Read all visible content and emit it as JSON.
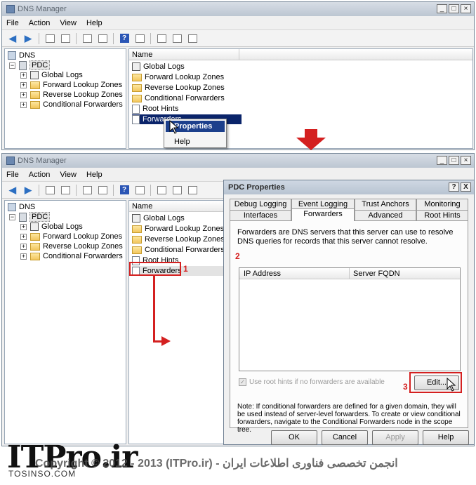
{
  "top_window": {
    "title": "DNS Manager",
    "menu": [
      "File",
      "Action",
      "View",
      "Help"
    ],
    "tree": {
      "root": "DNS",
      "server": "PDC",
      "children": [
        "Global Logs",
        "Forward Lookup Zones",
        "Reverse Lookup Zones",
        "Conditional Forwarders"
      ]
    },
    "list_header": "Name",
    "list_items": [
      "Global Logs",
      "Forward Lookup Zones",
      "Reverse Lookup Zones",
      "Conditional Forwarders",
      "Root Hints",
      "Forwarders"
    ],
    "context_menu": [
      "Properties",
      "Help"
    ]
  },
  "bottom_window": {
    "title": "DNS Manager",
    "menu": [
      "File",
      "Action",
      "View",
      "Help"
    ],
    "tree": {
      "root": "DNS",
      "server": "PDC",
      "children": [
        "Global Logs",
        "Forward Lookup Zones",
        "Reverse Lookup Zones",
        "Conditional Forwarders"
      ]
    },
    "list_header": "Name",
    "list_items": [
      "Global Logs",
      "Forward Lookup Zones",
      "Reverse Lookup Zones",
      "Conditional Forwarders",
      "Root Hints",
      "Forwarders"
    ]
  },
  "dialog": {
    "title": "PDC Properties",
    "help_btn": "?",
    "close_btn": "X",
    "tabs_row1": [
      "Debug Logging",
      "Event Logging",
      "Trust Anchors",
      "Monitoring"
    ],
    "tabs_row2": [
      "Interfaces",
      "Forwarders",
      "Advanced",
      "Root Hints"
    ],
    "description": "Forwarders are DNS servers that this server can use to resolve DNS queries for records that this server cannot resolve.",
    "columns": [
      "IP Address",
      "Server FQDN"
    ],
    "use_root_hints": "Use root hints if no forwarders are available",
    "edit_button": "Edit...",
    "note": "Note: If conditional forwarders are defined for a given domain, they will be used instead of server-level forwarders.  To create or view conditional forwarders, navigate to the Conditional Forwarders node in the scope tree.",
    "buttons": [
      "OK",
      "Cancel",
      "Apply",
      "Help"
    ]
  },
  "annotations": {
    "step1": "1",
    "step2": "2",
    "step3": "3",
    "color": "#d42020"
  },
  "watermark": {
    "logo": "ITPro.ir",
    "copyright": "Copyright © 2012 - 2013 (ITPro.ir) - انجمن تخصصی فناوری اطلاعات ایران",
    "site": "TOSINSO.COM"
  }
}
